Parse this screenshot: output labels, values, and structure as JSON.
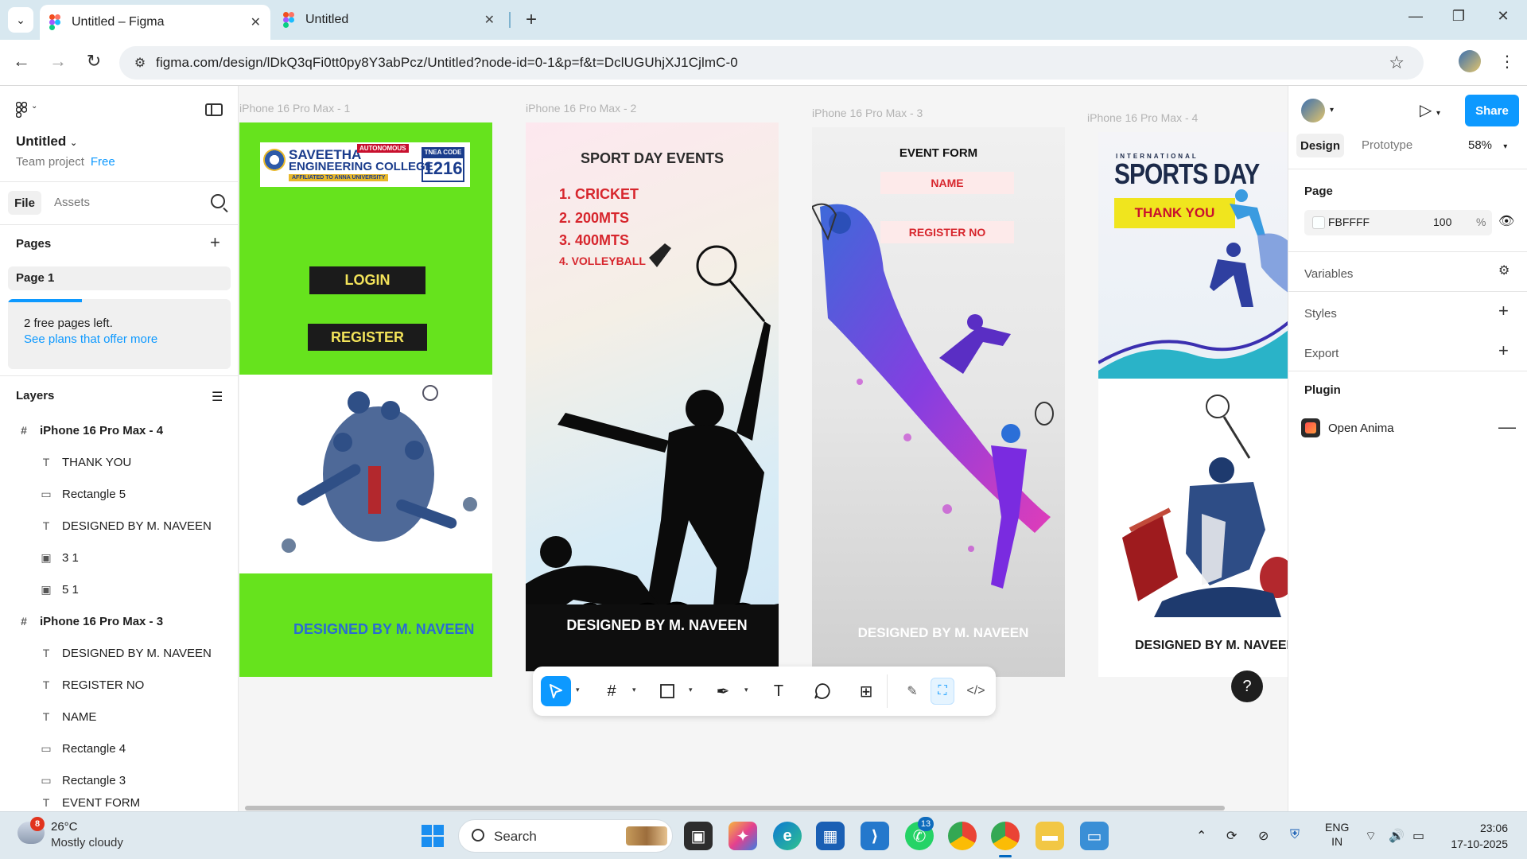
{
  "browser": {
    "tabs": [
      {
        "title": "Untitled – Figma",
        "active": true
      },
      {
        "title": "Untitled",
        "active": false
      }
    ],
    "url": "figma.com/design/lDkQ3qFi0tt0py8Y3abPcz/Untitled?node-id=0-1&p=f&t=DclUGUhjXJ1CjlmC-0"
  },
  "left_panel": {
    "file_name": "Untitled",
    "team": "Team project",
    "plan": "Free",
    "tabs": {
      "file": "File",
      "assets": "Assets"
    },
    "pages_title": "Pages",
    "page_item": "Page 1",
    "free_pages_text": "2 free pages left.",
    "plans_link": "See plans that offer more",
    "layers_title": "Layers",
    "layers": [
      {
        "name": "iPhone 16 Pro Max - 4",
        "type": "frame",
        "icon": "#"
      },
      {
        "name": "THANK YOU",
        "type": "text",
        "icon": "T"
      },
      {
        "name": "Rectangle 5",
        "type": "rectangle",
        "icon": "▭"
      },
      {
        "name": "DESIGNED BY M. NAVEEN",
        "type": "text",
        "icon": "T"
      },
      {
        "name": "3 1",
        "type": "image",
        "icon": "▣"
      },
      {
        "name": "5 1",
        "type": "image",
        "icon": "▣"
      },
      {
        "name": "iPhone 16 Pro Max - 3",
        "type": "frame",
        "icon": "#"
      },
      {
        "name": "DESIGNED BY M. NAVEEN",
        "type": "text",
        "icon": "T"
      },
      {
        "name": "REGISTER NO",
        "type": "text",
        "icon": "T"
      },
      {
        "name": "NAME",
        "type": "text",
        "icon": "T"
      },
      {
        "name": "Rectangle 4",
        "type": "rectangle",
        "icon": "▭"
      },
      {
        "name": "Rectangle 3",
        "type": "rectangle",
        "icon": "▭"
      },
      {
        "name": "EVENT FORM",
        "type": "text",
        "icon": "T"
      }
    ]
  },
  "canvas": {
    "frame_labels": [
      "iPhone 16 Pro Max - 1",
      "iPhone 16 Pro Max - 2",
      "iPhone 16 Pro Max - 3",
      "iPhone 16 Pro Max - 4"
    ],
    "frame1": {
      "college_line1": "SAVEETHA",
      "college_line2": "ENGINEERING COLLEGE",
      "autonomous": "AUTONOMOUS",
      "affiliation": "AFFILIATED TO ANNA UNIVERSITY",
      "tnea_label": "TNEA CODE",
      "tnea_code": "1216",
      "login": "LOGIN",
      "register": "REGISTER",
      "designed_by": "DESIGNED BY M. NAVEEN"
    },
    "frame2": {
      "title": "SPORT DAY EVENTS",
      "events": [
        "1.  CRICKET",
        "2. 200MTS",
        "3. 400MTS",
        "4. VOLLEYBALL"
      ],
      "designed_by": "DESIGNED BY M. NAVEEN"
    },
    "frame3": {
      "title": "EVENT FORM",
      "name_field": "NAME",
      "register_field": "REGISTER NO",
      "designed_by": "DESIGNED BY M. NAVEEN"
    },
    "frame4": {
      "international": "INTERNATIONAL",
      "sports_day": "SPORTS DAY",
      "thank_you": "THANK YOU",
      "designed_by": "DESIGNED BY M. NAVEEN"
    }
  },
  "toolbar_tools": [
    "move-tool",
    "frame-tool",
    "shape-tool",
    "pen-tool",
    "text-tool",
    "comment-tool",
    "actions-tool",
    "draw-mode",
    "design-mode",
    "dev-mode"
  ],
  "right_panel": {
    "share": "Share",
    "tabs": {
      "design": "Design",
      "prototype": "Prototype"
    },
    "zoom": "58%",
    "page_title": "Page",
    "bg_hex": "FBFFFF",
    "bg_opacity": "100",
    "percent": "%",
    "variables": "Variables",
    "styles": "Styles",
    "export": "Export",
    "plugin_title": "Plugin",
    "plugin_name": "Open Anima"
  },
  "help": "?",
  "taskbar": {
    "weather_badge": "8",
    "temperature": "26°C",
    "weather": "Mostly cloudy",
    "search": "Search",
    "whatsapp_badge": "13",
    "lang1": "ENG",
    "lang2": "IN",
    "time": "23:06",
    "date": "17-10-2025"
  },
  "colors": {
    "figma_blue": "#0d99ff",
    "green": "#66e31d",
    "red_text": "#d7262d"
  }
}
